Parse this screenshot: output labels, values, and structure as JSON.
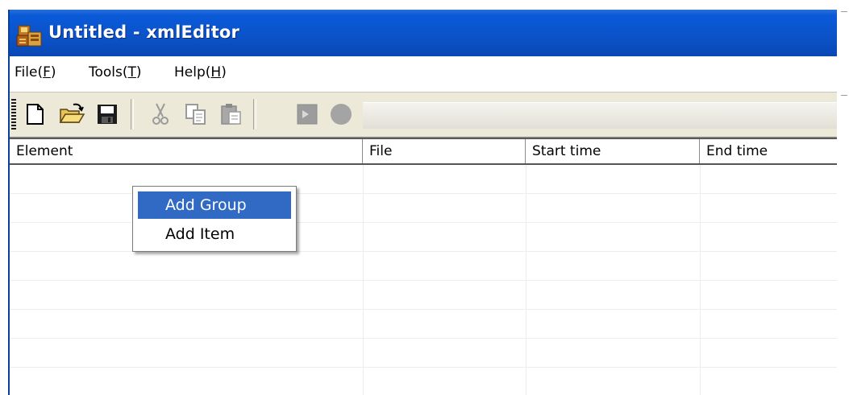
{
  "window": {
    "title": "Untitled - xmlEditor",
    "app_icon": "xml-app-icon"
  },
  "menubar": {
    "items": [
      {
        "label": "File(",
        "accel": "F",
        "end": ")"
      },
      {
        "label": "Tools(",
        "accel": "T",
        "end": ")"
      },
      {
        "label": "Help(",
        "accel": "H",
        "end": ")"
      }
    ]
  },
  "toolbar": {
    "buttons": [
      {
        "icon": "new-file-icon",
        "enabled": true
      },
      {
        "icon": "open-folder-icon",
        "enabled": true
      },
      {
        "icon": "save-icon",
        "enabled": true
      },
      {
        "icon": "cut-icon",
        "enabled": false
      },
      {
        "icon": "copy-icon",
        "enabled": false
      },
      {
        "icon": "paste-icon",
        "enabled": false
      },
      {
        "icon": "stop-icon",
        "enabled": false
      },
      {
        "icon": "record-icon",
        "enabled": false
      }
    ]
  },
  "table": {
    "columns": [
      "Element",
      "File",
      "Start time",
      "End time"
    ],
    "rows": []
  },
  "context_menu": {
    "items": [
      {
        "label": "Add Group",
        "selected": true
      },
      {
        "label": "Add Item",
        "selected": false
      }
    ]
  },
  "colors": {
    "titlebar": "#0b52c8",
    "selection": "#316ac5",
    "toolbar_bg": "#ece9d8"
  }
}
